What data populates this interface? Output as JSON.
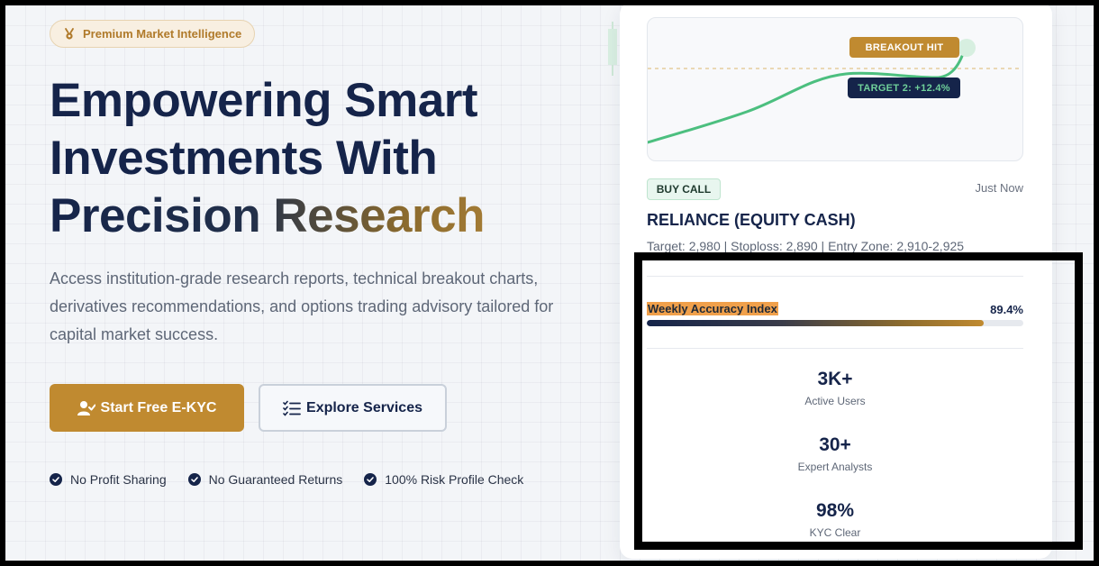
{
  "hero": {
    "badge": "Premium Market Intelligence",
    "title_line1": "Empowering Smart",
    "title_line2": "Investments With",
    "title_line3_a": "Precision",
    "title_line3_b": "Research",
    "description": "Access institution-grade research reports, technical breakout charts, derivatives recommendations, and options trading advisory tailored for capital market success.",
    "primary_button": "Start Free E-KYC",
    "secondary_button": "Explore Services",
    "checks": [
      "No Profit Sharing",
      "No Guaranteed Returns",
      "100% Risk Profile Check"
    ]
  },
  "card": {
    "breakout_label": "BREAKOUT HIT",
    "target_label": "TARGET 2: +12.4%",
    "call_badge": "BUY CALL",
    "time": "Just Now",
    "stock": "RELIANCE (EQUITY CASH)",
    "levels": "Target: 2,980 | Stoploss: 2,890 | Entry Zone: 2,910-2,925",
    "accuracy_label": "Weekly Accuracy Index",
    "accuracy_value": "89.4%",
    "accuracy_fraction": 0.894,
    "stats": [
      {
        "value": "3K+",
        "label": "Active Users"
      },
      {
        "value": "30+",
        "label": "Expert Analysts"
      },
      {
        "value": "98%",
        "label": "KYC Clear"
      }
    ]
  },
  "colors": {
    "navy": "#15244a",
    "gold": "#c08a30",
    "green": "#4cbf7f",
    "highlight": "#f0a04b"
  }
}
